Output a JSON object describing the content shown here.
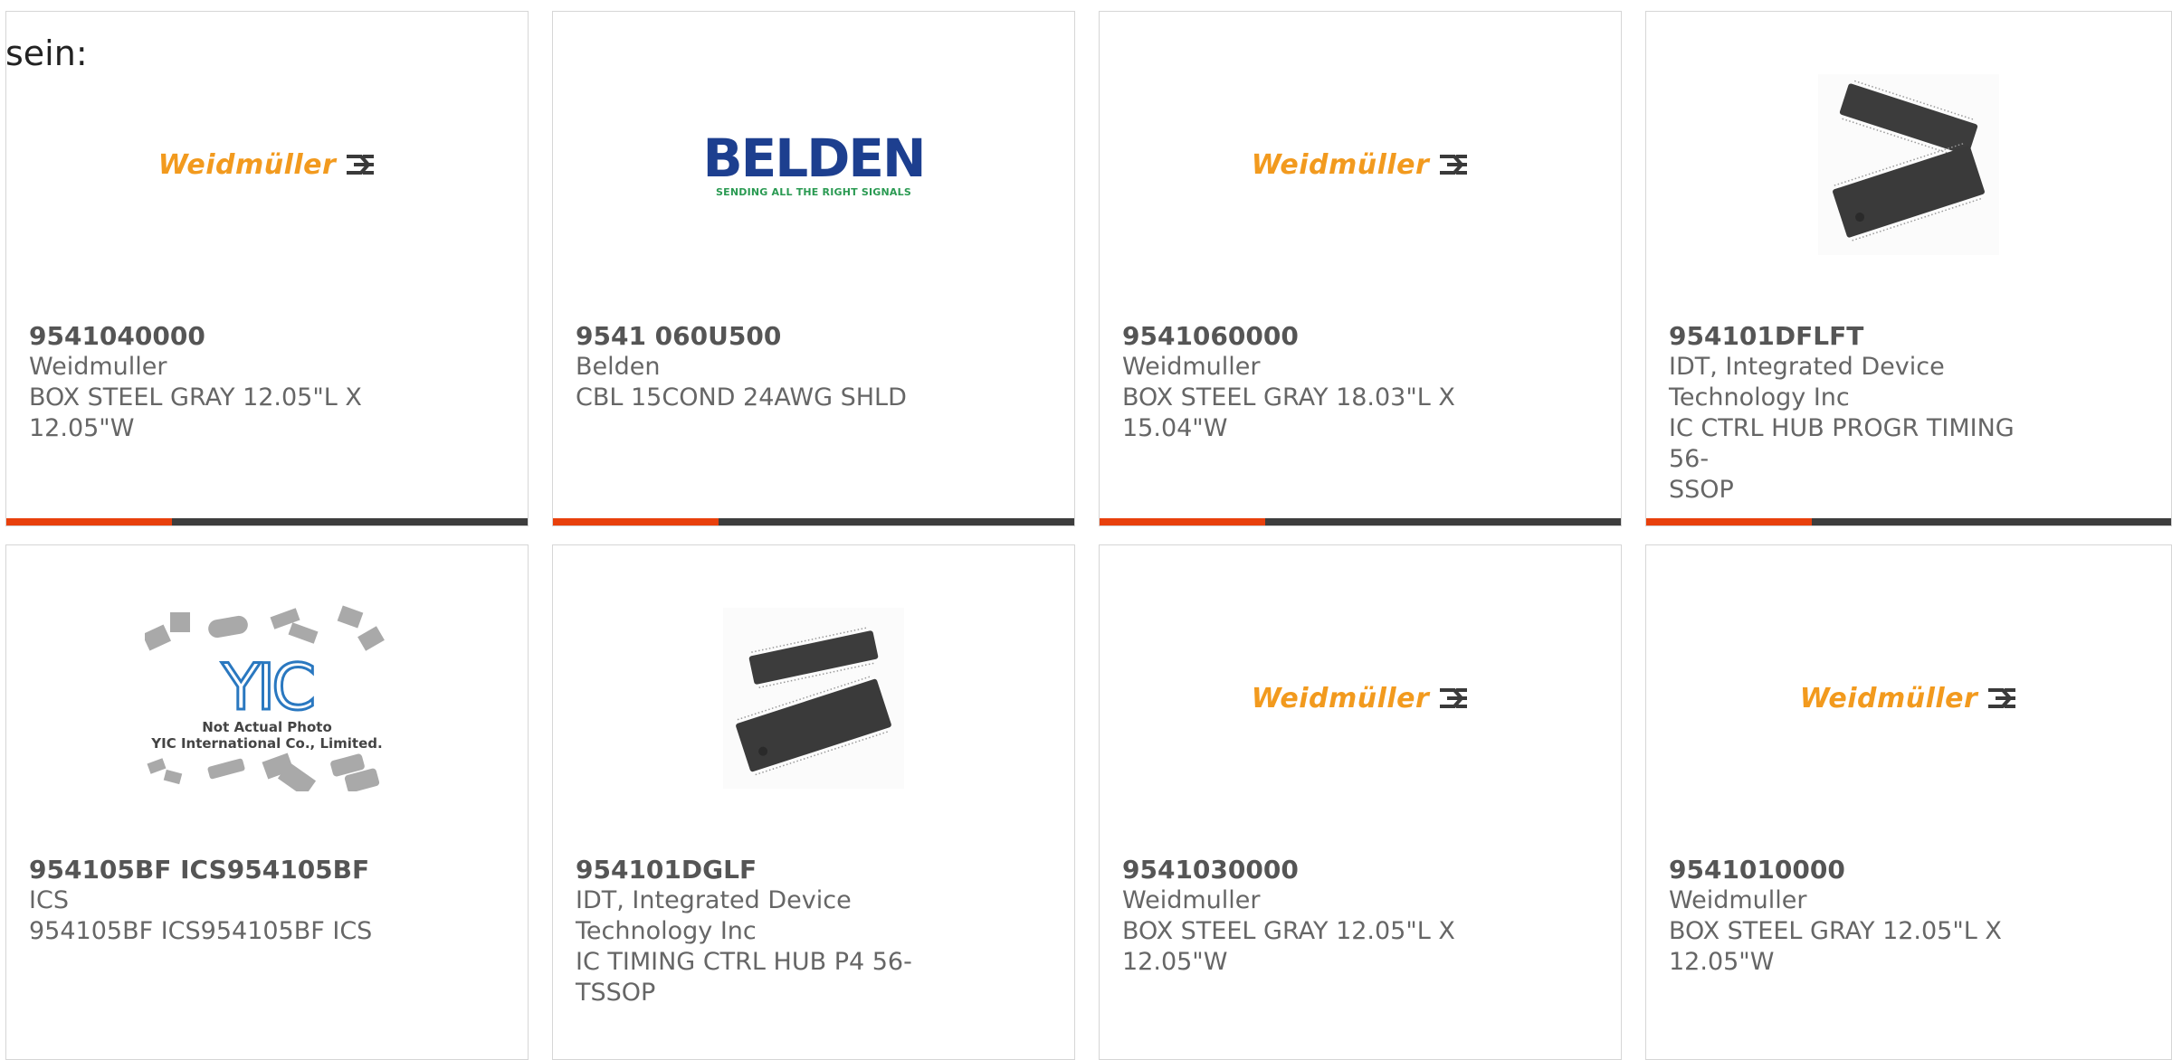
{
  "prefix_text": "sein:",
  "accent_color": "#e8400c",
  "cards": [
    {
      "part_number": "9541040000",
      "manufacturer": "Weidmuller",
      "description_lines": [
        "BOX STEEL GRAY 12.05\"L X",
        "12.05\"W"
      ],
      "image": "weidmuller-logo",
      "logo_text": "Weidmüller"
    },
    {
      "part_number": "9541 060U500",
      "manufacturer": "Belden",
      "description_lines": [
        "CBL 15COND 24AWG SHLD"
      ],
      "image": "belden-logo",
      "logo_text": "BELDEN",
      "logo_tagline": "SENDING ALL THE RIGHT SIGNALS"
    },
    {
      "part_number": "9541060000",
      "manufacturer": "Weidmuller",
      "description_lines": [
        "BOX STEEL GRAY 18.03\"L X",
        "15.04\"W"
      ],
      "image": "weidmuller-logo",
      "logo_text": "Weidmüller"
    },
    {
      "part_number": "954101DFLFT",
      "manufacturer_lines": [
        "IDT, Integrated Device",
        "Technology Inc"
      ],
      "description_lines": [
        "IC CTRL HUB PROGR TIMING 56-",
        "SSOP"
      ],
      "image": "ic-chip-photo"
    },
    {
      "part_number": "954105BF ICS954105BF",
      "manufacturer": "ICS",
      "description_lines": [
        "954105BF ICS954105BF ICS"
      ],
      "image": "yic-placeholder",
      "logo_text": "YIC",
      "placeholder_line1": "Not Actual Photo",
      "placeholder_line2": "YIC International Co., Limited."
    },
    {
      "part_number": "954101DGLF",
      "manufacturer_lines": [
        "IDT, Integrated Device",
        "Technology Inc"
      ],
      "description_lines": [
        "IC TIMING CTRL HUB P4 56-",
        "TSSOP"
      ],
      "image": "ic-chip-photo"
    },
    {
      "part_number": "9541030000",
      "manufacturer": "Weidmuller",
      "description_lines": [
        "BOX STEEL GRAY 12.05\"L X",
        "12.05\"W"
      ],
      "image": "weidmuller-logo",
      "logo_text": "Weidmüller"
    },
    {
      "part_number": "9541010000",
      "manufacturer": "Weidmuller",
      "description_lines": [
        "BOX STEEL GRAY 12.05\"L X",
        "12.05\"W"
      ],
      "image": "weidmuller-logo",
      "logo_text": "Weidmüller"
    }
  ]
}
